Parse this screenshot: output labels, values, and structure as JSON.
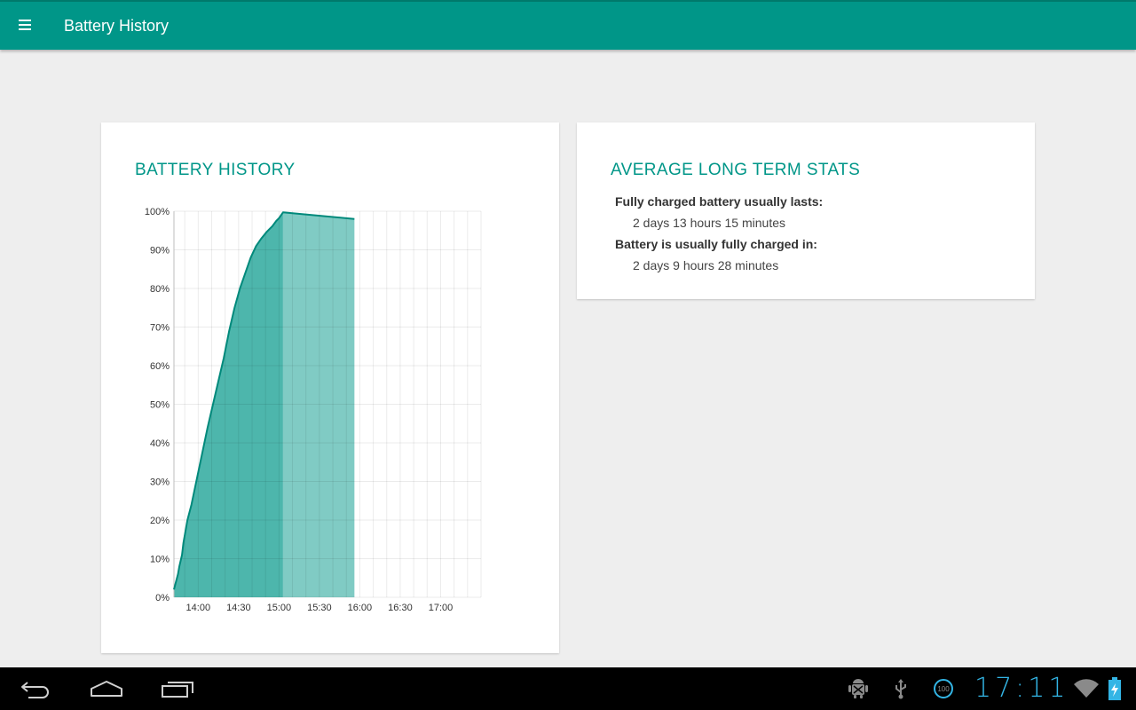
{
  "appbar": {
    "title": "Battery History",
    "menu_icon": "hamburger-menu-icon",
    "color": "#009688"
  },
  "history_card": {
    "title": "BATTERY HISTORY"
  },
  "chart_data": {
    "type": "area",
    "title": "",
    "xlabel": "",
    "ylabel": "",
    "y_ticks": [
      "0%",
      "10%",
      "20%",
      "30%",
      "40%",
      "50%",
      "60%",
      "70%",
      "80%",
      "90%",
      "100%"
    ],
    "x_ticks": [
      "14:00",
      "14:30",
      "15:00",
      "15:30",
      "16:00",
      "16:30",
      "17:00"
    ],
    "ylim": [
      0,
      100
    ],
    "xlim_minutes_of_day": [
      822,
      1050
    ],
    "grid": true,
    "series": [
      {
        "kind": "measured",
        "color": "#4db6ac",
        "points": [
          [
            "13:42",
            2
          ],
          [
            "13:45",
            6
          ],
          [
            "13:46",
            8
          ],
          [
            "13:48",
            11
          ],
          [
            "13:49",
            14
          ],
          [
            "13:52",
            20
          ],
          [
            "13:55",
            24
          ],
          [
            "13:58",
            29
          ],
          [
            "14:01",
            34
          ],
          [
            "14:04",
            39
          ],
          [
            "14:07",
            44
          ],
          [
            "14:11",
            50
          ],
          [
            "14:15",
            56
          ],
          [
            "14:19",
            62
          ],
          [
            "14:23",
            69
          ],
          [
            "14:27",
            75
          ],
          [
            "14:31",
            80
          ],
          [
            "14:35",
            84
          ],
          [
            "14:39",
            88
          ],
          [
            "14:43",
            91
          ],
          [
            "14:47",
            93
          ],
          [
            "14:51",
            94.7
          ],
          [
            "14:55",
            96.1
          ],
          [
            "14:58",
            97.5
          ],
          [
            "15:00",
            98.2
          ],
          [
            "15:02",
            99.2
          ],
          [
            "15:03",
            99.7
          ]
        ]
      },
      {
        "kind": "projected",
        "color": "#80cbc4",
        "points": [
          [
            "15:03",
            99.7
          ],
          [
            "15:56",
            98
          ]
        ]
      }
    ],
    "line_color": "#00897b"
  },
  "stats_card": {
    "title": "AVERAGE LONG TERM STATS",
    "items": [
      {
        "label": "Fully charged battery usually lasts:",
        "value": "2 days 13 hours 15 minutes"
      },
      {
        "label": "Battery is usually fully charged in:",
        "value": "2 days 9 hours 28 minutes"
      }
    ]
  },
  "navbar": {
    "back_icon": "back-icon",
    "home_icon": "home-icon",
    "recents_icon": "recent-apps-icon",
    "status_icons": [
      "android-debug-icon",
      "usb-icon",
      "battery-100-notification-icon",
      "wifi-icon",
      "battery-charging-icon"
    ],
    "battery_notification_value": "100",
    "clock": "17:11",
    "clock_color": "#33b5e5"
  }
}
